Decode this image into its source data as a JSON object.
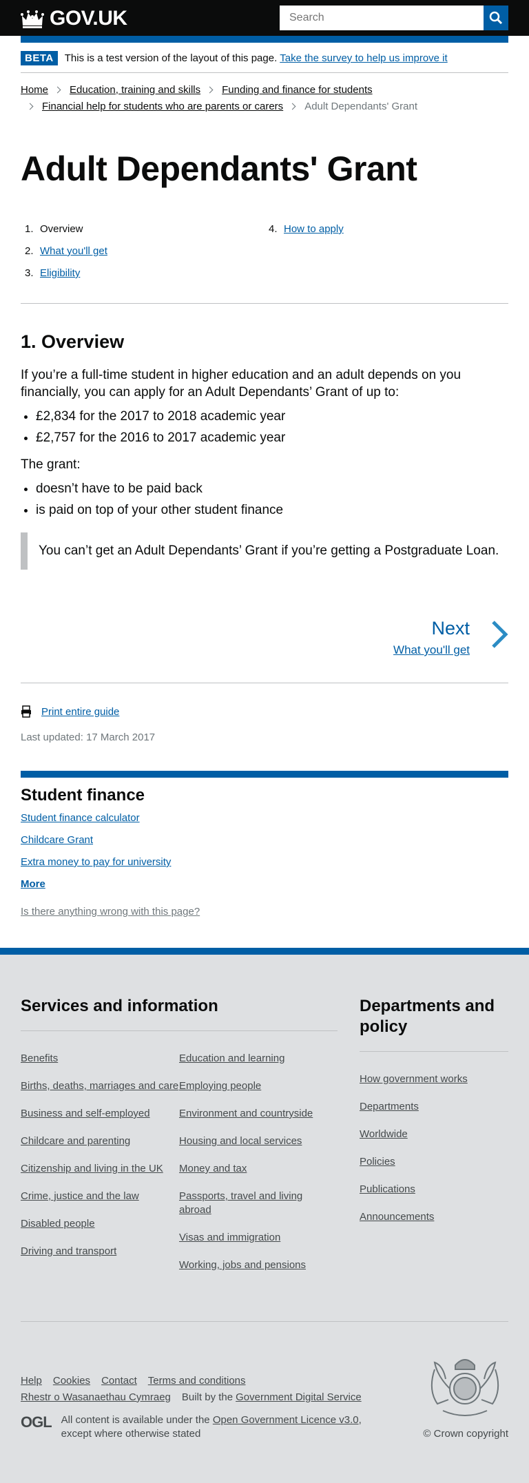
{
  "header": {
    "logo_text": "GOV.UK",
    "search_placeholder": "Search"
  },
  "beta": {
    "tag": "BETA",
    "text": "This is a test version of the layout of this page.",
    "link": "Take the survey to help us improve it"
  },
  "breadcrumbs": [
    "Home",
    "Education, training and skills",
    "Funding and finance for students",
    "Financial help for students who are parents or carers",
    "Adult Dependants' Grant"
  ],
  "page_title": "Adult Dependants' Grant",
  "contents": [
    {
      "num": "1.",
      "label": "Overview",
      "current": true
    },
    {
      "num": "2.",
      "label": "What you'll get",
      "current": false
    },
    {
      "num": "3.",
      "label": "Eligibility",
      "current": false
    },
    {
      "num": "4.",
      "label": "How to apply",
      "current": false
    }
  ],
  "section": {
    "heading": "1. Overview",
    "intro": "If you’re a full-time student in higher education and an adult depends on you financially, you can apply for an Adult Dependants’ Grant of up to:",
    "amounts": [
      "£2,834 for the 2017 to 2018 academic year",
      "£2,757 for the 2016 to 2017 academic year"
    ],
    "grant_label": "The grant:",
    "grant_points": [
      "doesn’t have to be paid back",
      "is paid on top of your other student finance"
    ],
    "inset": "You can’t get an Adult Dependants’ Grant if you’re getting a Postgraduate Loan."
  },
  "pagination": {
    "next": "Next",
    "next_page": "What you'll get"
  },
  "print_link": "Print entire guide",
  "last_updated": "Last updated: 17 March 2017",
  "related": {
    "heading": "Student finance",
    "links": [
      "Student finance calculator",
      "Childcare Grant",
      "Extra money to pay for university"
    ],
    "more": "More"
  },
  "report_link": "Is there anything wrong with this page?",
  "footer": {
    "services_heading": "Services and information",
    "services_col1": [
      "Benefits",
      "Births, deaths, marriages and care",
      "Business and self-employed",
      "Childcare and parenting",
      "Citizenship and living in the UK",
      "Crime, justice and the law",
      "Disabled people",
      "Driving and transport"
    ],
    "services_col2": [
      "Education and learning",
      "Employing people",
      "Environment and countryside",
      "Housing and local services",
      "Money and tax",
      "Passports, travel and living abroad",
      "Visas and immigration",
      "Working, jobs and pensions"
    ],
    "depts_heading": "Departments and policy",
    "depts": [
      "How government works",
      "Departments",
      "Worldwide",
      "Policies",
      "Publications",
      "Announcements"
    ],
    "meta_links": [
      "Help",
      "Cookies",
      "Contact",
      "Terms and conditions"
    ],
    "welsh": "Rhestr o Wasanaethau Cymraeg",
    "built_by": "Built by the",
    "gds": "Government Digital Service",
    "ogl": "OGL",
    "license_pre": "All content is available under the",
    "license_link": "Open Government Licence v3.0",
    "license_post": ", except where otherwise stated",
    "copyright": "© Crown copyright"
  }
}
